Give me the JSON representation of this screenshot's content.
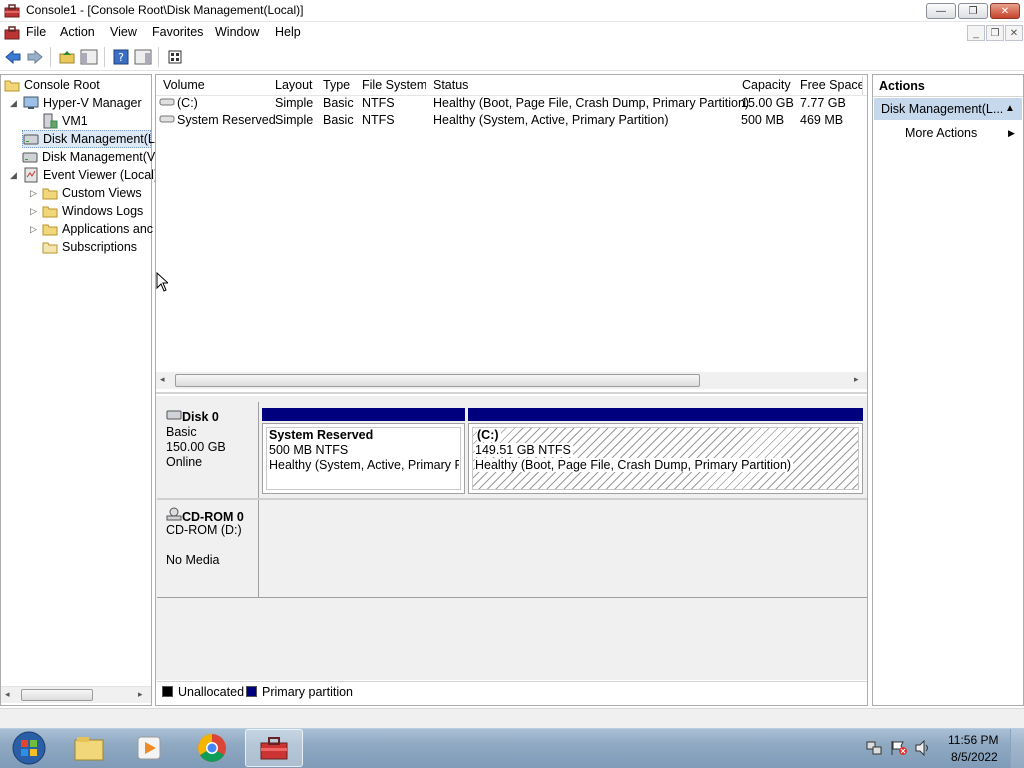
{
  "window": {
    "title": "Console1 - [Console Root\\Disk Management(Local)]",
    "buttons": {
      "minimize": "—",
      "maximize": "❐",
      "close": "✕"
    }
  },
  "menu": {
    "items": [
      "File",
      "Action",
      "View",
      "Favorites",
      "Window",
      "Help"
    ],
    "mdi_buttons": {
      "minimize": "_",
      "restore": "❐",
      "close": "✕"
    }
  },
  "toolbar": {
    "icons": [
      "back-arrow-icon",
      "forward-arrow-icon",
      "up-folder-icon",
      "show-hide-tree-icon",
      "help-icon",
      "show-hide-action-pane-icon",
      "properties-icon"
    ]
  },
  "tree": {
    "items": [
      {
        "label": "Console Root",
        "icon": "folder-icon"
      },
      {
        "label": "Hyper-V Manager",
        "icon": "hyperv-icon"
      },
      {
        "label": "VM1",
        "icon": "server-icon"
      },
      {
        "label": "Disk Management(L",
        "icon": "disk-icon"
      },
      {
        "label": "Disk Management(V",
        "icon": "disk-icon"
      },
      {
        "label": "Event Viewer (Local)",
        "icon": "event-viewer-icon"
      },
      {
        "label": "Custom Views",
        "icon": "folder-icon"
      },
      {
        "label": "Windows Logs",
        "icon": "folder-icon"
      },
      {
        "label": "Applications anc",
        "icon": "folder-icon"
      },
      {
        "label": "Subscriptions",
        "icon": "subscriptions-icon"
      }
    ]
  },
  "volumes": {
    "headers": [
      "Volume",
      "Layout",
      "Type",
      "File System",
      "Status",
      "Capacity",
      "Free Space"
    ],
    "rows": [
      {
        "volume": "(C:)",
        "layout": "Simple",
        "type": "Basic",
        "fs": "NTFS",
        "status": "Healthy (Boot, Page File, Crash Dump, Primary Partition)",
        "capacity": "15.00 GB",
        "free": "7.77 GB"
      },
      {
        "volume": "System Reserved",
        "layout": "Simple",
        "type": "Basic",
        "fs": "NTFS",
        "status": "Healthy (System, Active, Primary Partition)",
        "capacity": "500 MB",
        "free": "469 MB"
      }
    ]
  },
  "disks": {
    "disk0": {
      "name": "Disk 0",
      "type": "Basic",
      "size": "150.00 GB",
      "state": "Online",
      "partitions": [
        {
          "name": "System Reserved",
          "size": "500 MB NTFS",
          "status": "Healthy (System, Active, Primary Pai"
        },
        {
          "name": "(C:)",
          "size": "149.51 GB NTFS",
          "status": "Healthy (Boot, Page File, Crash Dump, Primary Partition)"
        }
      ]
    },
    "cdrom0": {
      "name": "CD-ROM 0",
      "drive": "CD-ROM (D:)",
      "media": "No Media"
    }
  },
  "legend": {
    "unallocated": "Unallocated",
    "primary": "Primary partition",
    "colors": {
      "unallocated": "#000000",
      "primary": "#00007f"
    }
  },
  "actions": {
    "title": "Actions",
    "section": "Disk Management(L...",
    "more": "More Actions"
  },
  "taskbar": {
    "apps": [
      "start-orb-icon",
      "explorer-icon",
      "media-player-icon",
      "chrome-icon",
      "mmc-toolbox-icon"
    ],
    "time": "11:56 PM",
    "date": "8/5/2022"
  }
}
